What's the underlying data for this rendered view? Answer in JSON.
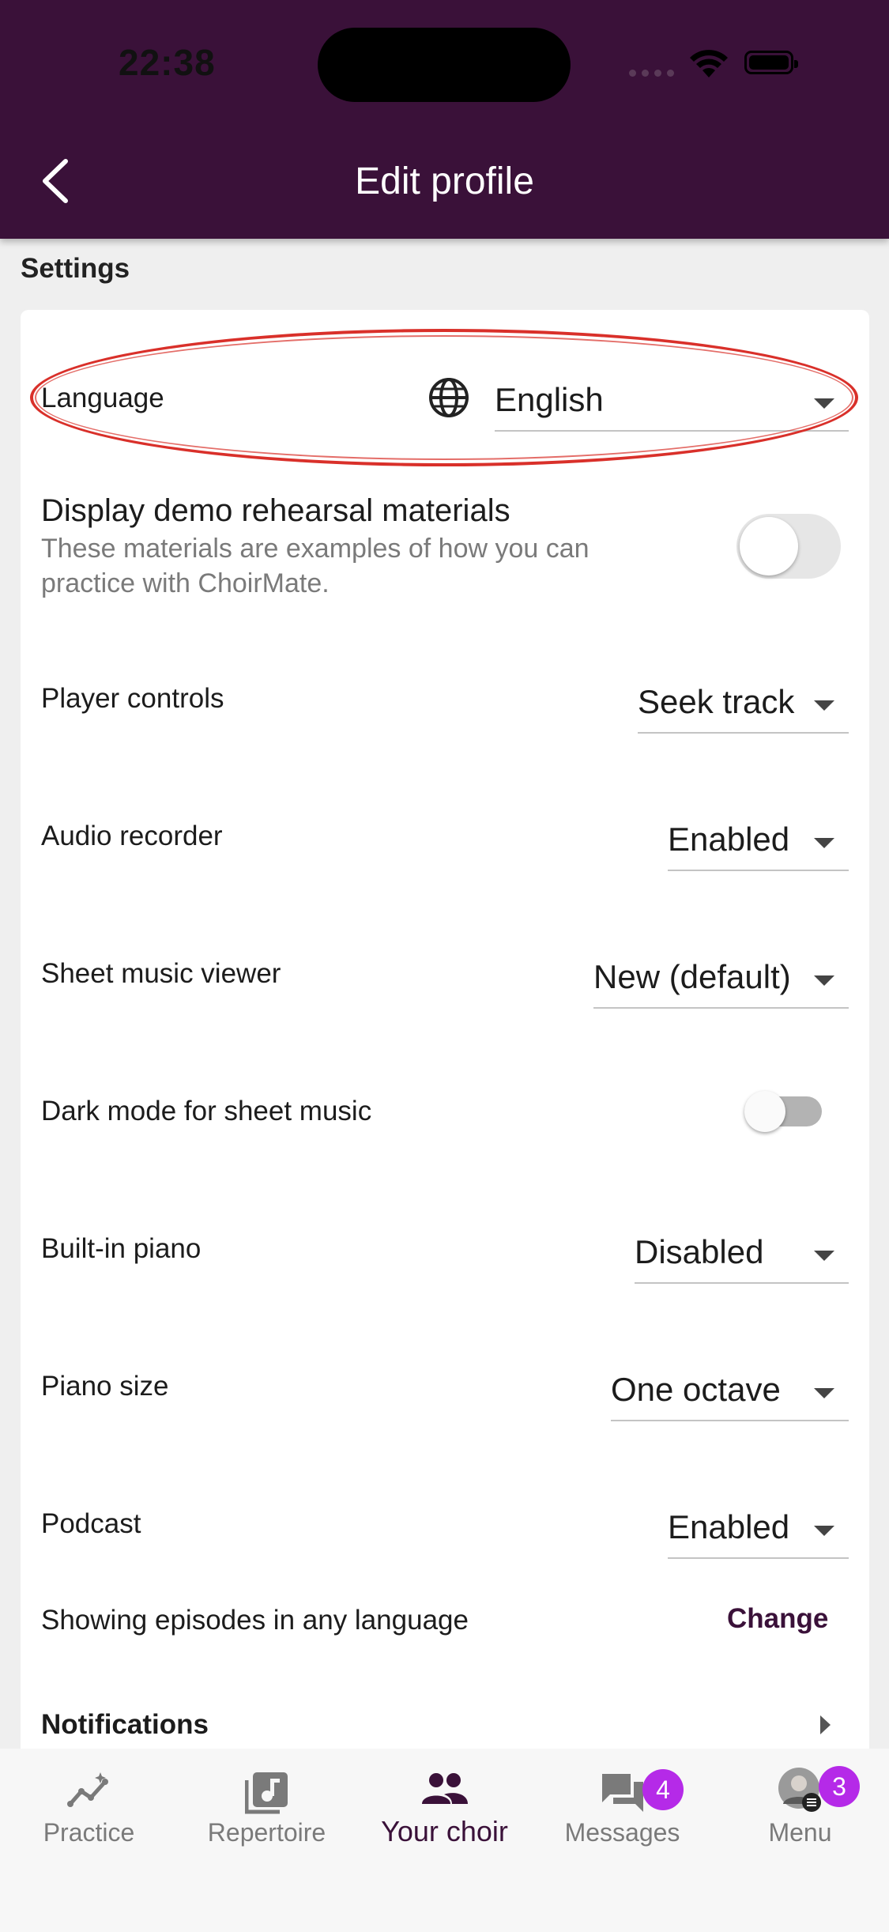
{
  "status_bar": {
    "time": "22:38"
  },
  "header": {
    "title": "Edit profile"
  },
  "settings": {
    "section_title": "Settings",
    "language": {
      "label": "Language",
      "value": "English"
    },
    "demo": {
      "title": "Display demo rehearsal materials",
      "description": "These materials are examples of how you can practice with ChoirMate.",
      "enabled": false
    },
    "player_controls": {
      "label": "Player controls",
      "value": "Seek track"
    },
    "audio_recorder": {
      "label": "Audio recorder",
      "value": "Enabled"
    },
    "sheet_music_viewer": {
      "label": "Sheet music viewer",
      "value": "New (default)"
    },
    "dark_mode": {
      "label": "Dark mode for sheet music",
      "enabled": false
    },
    "builtin_piano": {
      "label": "Built-in piano",
      "value": "Disabled"
    },
    "piano_size": {
      "label": "Piano size",
      "value": "One octave"
    },
    "podcast": {
      "label": "Podcast",
      "value": "Enabled"
    },
    "episodes": {
      "label": "Showing episodes in any language",
      "action": "Change"
    },
    "notifications": {
      "label": "Notifications"
    }
  },
  "bottom_nav": {
    "items": [
      {
        "label": "Practice",
        "icon": "practice-icon"
      },
      {
        "label": "Repertoire",
        "icon": "music-note-icon"
      },
      {
        "label": "Your choir",
        "icon": "group-icon",
        "active": true
      },
      {
        "label": "Messages",
        "icon": "chat-icon",
        "badge": "4"
      },
      {
        "label": "Menu",
        "icon": "avatar-icon",
        "badge": "3"
      }
    ]
  },
  "colors": {
    "header_bg": "#3a1139",
    "accent": "#3a1139",
    "badge": "#b52ae8",
    "highlight_oval": "#d9302a"
  }
}
